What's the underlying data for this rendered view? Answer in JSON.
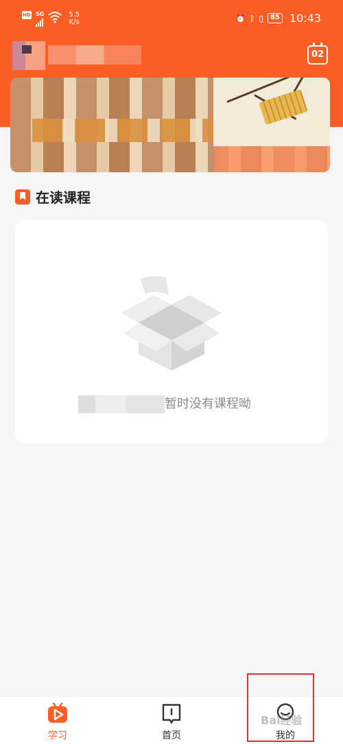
{
  "status_bar": {
    "hd": "HD",
    "network": "5G",
    "speed_value": "5.5",
    "speed_unit": "K/s",
    "battery": "85",
    "time": "10:43"
  },
  "header": {
    "calendar_day": "02"
  },
  "section": {
    "title": "在读课程"
  },
  "empty_state": {
    "message": "暂时没有课程呦"
  },
  "tabbar": {
    "tabs": [
      {
        "label": "学习",
        "icon": "tv-play-icon",
        "active": true
      },
      {
        "label": "首页",
        "icon": "book-icon",
        "active": false
      },
      {
        "label": "我的",
        "icon": "person-icon",
        "active": false
      }
    ]
  },
  "colors": {
    "accent": "#fb5e25",
    "highlight_box": "#e0302d"
  }
}
